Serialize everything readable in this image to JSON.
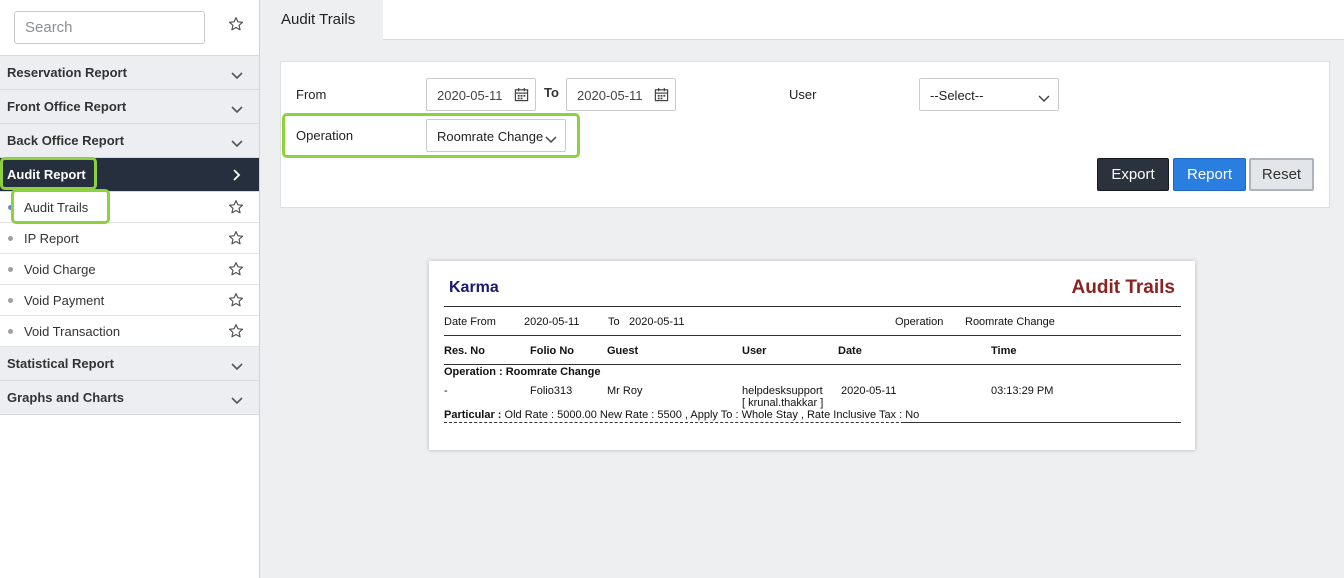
{
  "sidebar": {
    "search_placeholder": "Search",
    "sections": [
      {
        "label": "Reservation Report"
      },
      {
        "label": "Front Office Report"
      },
      {
        "label": "Back Office Report"
      },
      {
        "label": "Audit Report"
      },
      {
        "label": "Statistical Report"
      },
      {
        "label": "Graphs and Charts"
      }
    ],
    "audit_items": [
      {
        "label": "Audit Trails"
      },
      {
        "label": "IP Report"
      },
      {
        "label": "Void Charge"
      },
      {
        "label": "Void Payment"
      },
      {
        "label": "Void Transaction"
      }
    ]
  },
  "tab": {
    "title": "Audit Trails"
  },
  "filter": {
    "from_label": "From",
    "from_value": "2020-05-11",
    "to_label": "To",
    "to_value": "2020-05-11",
    "user_label": "User",
    "user_value": "--Select--",
    "operation_label": "Operation",
    "operation_value": "Roomrate Change",
    "export_label": "Export",
    "report_label": "Report",
    "reset_label": "Reset"
  },
  "report": {
    "company": "Karma",
    "title": "Audit Trails",
    "date_from_label": "Date From",
    "date_from": "2020-05-11",
    "to_label": "To",
    "to": "2020-05-11",
    "operation_label": "Operation",
    "operation": "Roomrate Change",
    "columns": [
      "Res. No",
      "Folio No",
      "Guest",
      "User",
      "Date",
      "Time"
    ],
    "group_label": "Operation : Roomrate Change",
    "row": {
      "res_no": "-",
      "folio_no": "Folio313",
      "guest": "Mr Roy",
      "user": "helpdesksupport",
      "user_sub": "[ krunal.thakkar ]",
      "date": "2020-05-11",
      "time": "03:13:29 PM"
    },
    "particular_label": "Particular :",
    "particular_text": " Old Rate : 5000.00 New Rate : 5500 , Apply To : Whole Stay , Rate Inclusive Tax : No"
  },
  "colors": {
    "active_section": "#262f3d",
    "highlight": "#8dd13f",
    "report_button": "#2a7ee0",
    "export_button": "#2a323e",
    "company_text": "#1a1a6e",
    "title_text": "#8b2323"
  }
}
